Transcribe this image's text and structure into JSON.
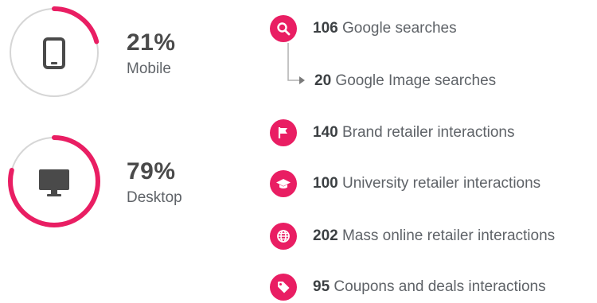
{
  "colors": {
    "accent": "#e91e63",
    "track": "#d6d6d6",
    "icon": "#4a4a4a",
    "text": "#5f6368"
  },
  "devices": [
    {
      "percent_label": "21%",
      "label": "Mobile",
      "share": 0.21,
      "icon": "smartphone-icon"
    },
    {
      "percent_label": "79%",
      "label": "Desktop",
      "share": 0.79,
      "icon": "desktop-monitor-icon"
    }
  ],
  "interactions": [
    {
      "count": "106",
      "label": "Google searches",
      "icon": "search-icon"
    },
    {
      "count": "20",
      "label": "Google Image searches",
      "icon": "arrow-right-icon"
    },
    {
      "count": "140",
      "label": "Brand retailer interactions",
      "icon": "flag-icon"
    },
    {
      "count": "100",
      "label": "University retailer interactions",
      "icon": "graduation-cap-icon"
    },
    {
      "count": "202",
      "label": "Mass online retailer interactions",
      "icon": "globe-icon"
    },
    {
      "count": "95",
      "label": "Coupons and deals interactions",
      "icon": "tag-icon"
    }
  ]
}
